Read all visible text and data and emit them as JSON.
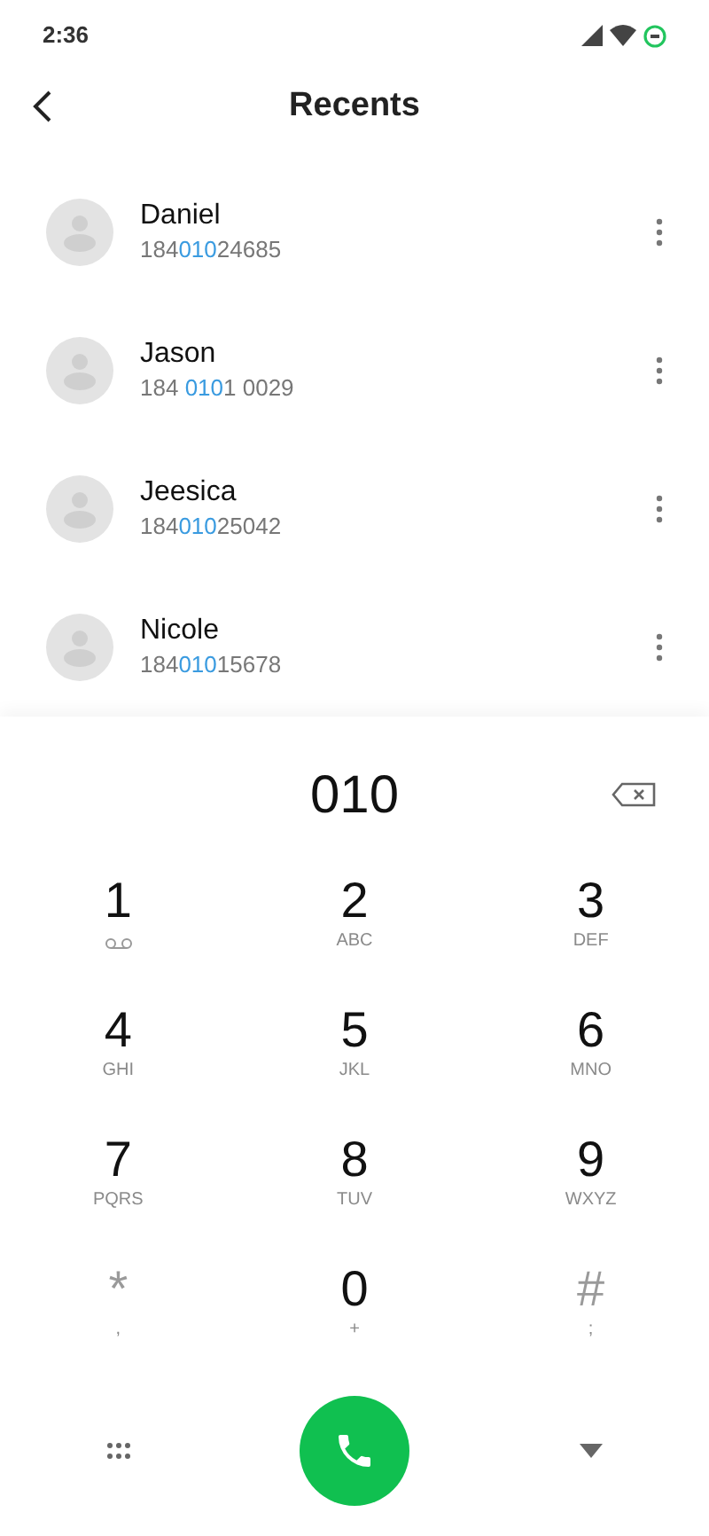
{
  "status_bar": {
    "time": "2:36"
  },
  "header": {
    "title": "Recents"
  },
  "recents": [
    {
      "name": "Daniel",
      "number": {
        "before": "184",
        "match": "010",
        "after": "24685"
      }
    },
    {
      "name": "Jason",
      "number": {
        "before": "184 ",
        "match": "010",
        "after": "1 0029"
      }
    },
    {
      "name": "Jeesica",
      "number": {
        "before": "184",
        "match": "010",
        "after": "25042"
      }
    },
    {
      "name": "Nicole",
      "number": {
        "before": "184",
        "match": "010",
        "after": "15678"
      }
    }
  ],
  "dialer": {
    "entered": "010",
    "keys": [
      {
        "main": "1",
        "kind": "voicemail"
      },
      {
        "main": "2",
        "sub": "ABC",
        "kind": "digit"
      },
      {
        "main": "3",
        "sub": "DEF",
        "kind": "digit"
      },
      {
        "main": "4",
        "sub": "GHI",
        "kind": "digit"
      },
      {
        "main": "5",
        "sub": "JKL",
        "kind": "digit"
      },
      {
        "main": "6",
        "sub": "MNO",
        "kind": "digit"
      },
      {
        "main": "7",
        "sub": "PQRS",
        "kind": "digit"
      },
      {
        "main": "8",
        "sub": "TUV",
        "kind": "digit"
      },
      {
        "main": "9",
        "sub": "WXYZ",
        "kind": "digit"
      },
      {
        "main": "*",
        "sub": ",",
        "kind": "symbol"
      },
      {
        "main": "0",
        "sub": "+",
        "kind": "digit"
      },
      {
        "main": "#",
        "sub": ";",
        "kind": "symbol"
      }
    ]
  }
}
